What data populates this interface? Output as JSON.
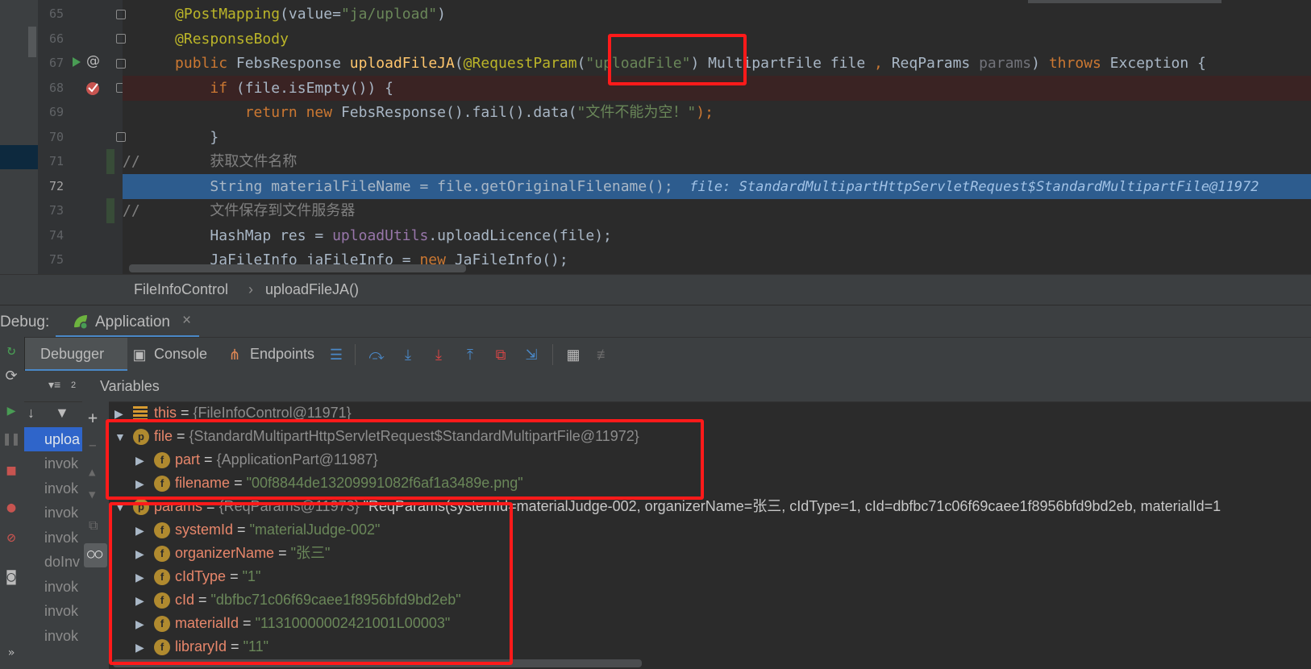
{
  "editor": {
    "lines": [
      {
        "num": "65"
      },
      {
        "num": "66"
      },
      {
        "num": "67"
      },
      {
        "num": "68"
      },
      {
        "num": "69"
      },
      {
        "num": "70"
      },
      {
        "num": "71"
      },
      {
        "num": "72"
      },
      {
        "num": "73"
      },
      {
        "num": "74"
      },
      {
        "num": "75"
      }
    ],
    "code": {
      "l65_ann": "@PostMapping",
      "l65_rest": "(value=",
      "l65_str": "\"ja/upload\"",
      "l65_end": ")",
      "l66_ann": "@ResponseBody",
      "l67_kw": "public",
      "l67_type": " FebsResponse ",
      "l67_fn": "uploadFileJA",
      "l67_p": "(",
      "l67_ann": "@RequestParam",
      "l67_p2": "(",
      "l67_str": "\"uploadFile\"",
      "l67_p3": ") MultipartFile file ",
      "l67_comma": ",",
      "l67_p4": " ReqParams ",
      "l67_param": "params",
      "l67_p5": ") ",
      "l67_throws": "throws",
      "l67_p6": " Exception {",
      "l68_kw": "if",
      "l68_rest": " (file.isEmpty()) {",
      "l69_kw1": "return",
      "l69_kw2": " new",
      "l69_rest": " FebsResponse().fail().data(",
      "l69_str": "\"文件不能为空！\"",
      "l69_end": ");",
      "l70": "}",
      "l71_cm": "//        获取文件名称",
      "l72_code": "String materialFileName = file.getOriginalFilename();",
      "l72_hint": "  file: StandardMultipartHttpServletRequest$StandardMultipartFile@11972",
      "l73_cm": "//        文件保存到文件服务器",
      "l74_a": "HashMap res = ",
      "l74_fld": "uploadUtils",
      "l74_b": ".uploadLicence(file);",
      "l75_a": "JaFileInfo jaFileInfo = ",
      "l75_kw": "new",
      "l75_b": " JaFileInfo();"
    }
  },
  "breadcrumb": {
    "class_name": "FileInfoControl",
    "separator": "›",
    "method": "uploadFileJA()"
  },
  "debug": {
    "title": "Debug:",
    "app_tab": "Application",
    "close": "×",
    "tabs": {
      "debugger": "Debugger",
      "console": "Console",
      "endpoints": "Endpoints"
    },
    "frames_count": "2",
    "frames": [
      "uploa",
      "invok",
      "invok",
      "invok",
      "invok",
      "doInv",
      "invok",
      "invok",
      "invok"
    ],
    "variables_header": "Variables"
  },
  "variables": {
    "this_name": "this",
    "this_val": "{FileInfoControl@11971}",
    "file_name": "file",
    "file_val": "{StandardMultipartHttpServletRequest$StandardMultipartFile@11972}",
    "part_name": "part",
    "part_val": "{ApplicationPart@11987}",
    "filename_name": "filename",
    "filename_val": "\"00f8844de13209991082f6af1a3489e.png\"",
    "params_name": "params",
    "params_val": "{ReqParams@11973}",
    "params_str": "\"ReqParams(systemId=materialJudge-002, organizerName=张三, cIdType=1, cId=dbfbc71c06f69caee1f8956bfd9bd2eb, materialId=1",
    "systemId_name": "systemId",
    "systemId_val": "\"materialJudge-002\"",
    "organizerName_name": "organizerName",
    "organizerName_val": "\"张三\"",
    "cIdType_name": "cIdType",
    "cIdType_val": "\"1\"",
    "cId_name": "cId",
    "cId_val": "\"dbfbc71c06f69caee1f8956bfd9bd2eb\"",
    "materialId_name": "materialId",
    "materialId_val": "\"11310000002421001L00003\"",
    "libraryId_name": "libraryId",
    "libraryId_val": "\"11\"",
    "eq": " = ",
    "badge_p": "p",
    "badge_f": "f"
  },
  "colors": {
    "highlight_box": "#ff1a1a",
    "exec_line": "#2d5c8e",
    "selected_frame": "#2f65ca"
  }
}
